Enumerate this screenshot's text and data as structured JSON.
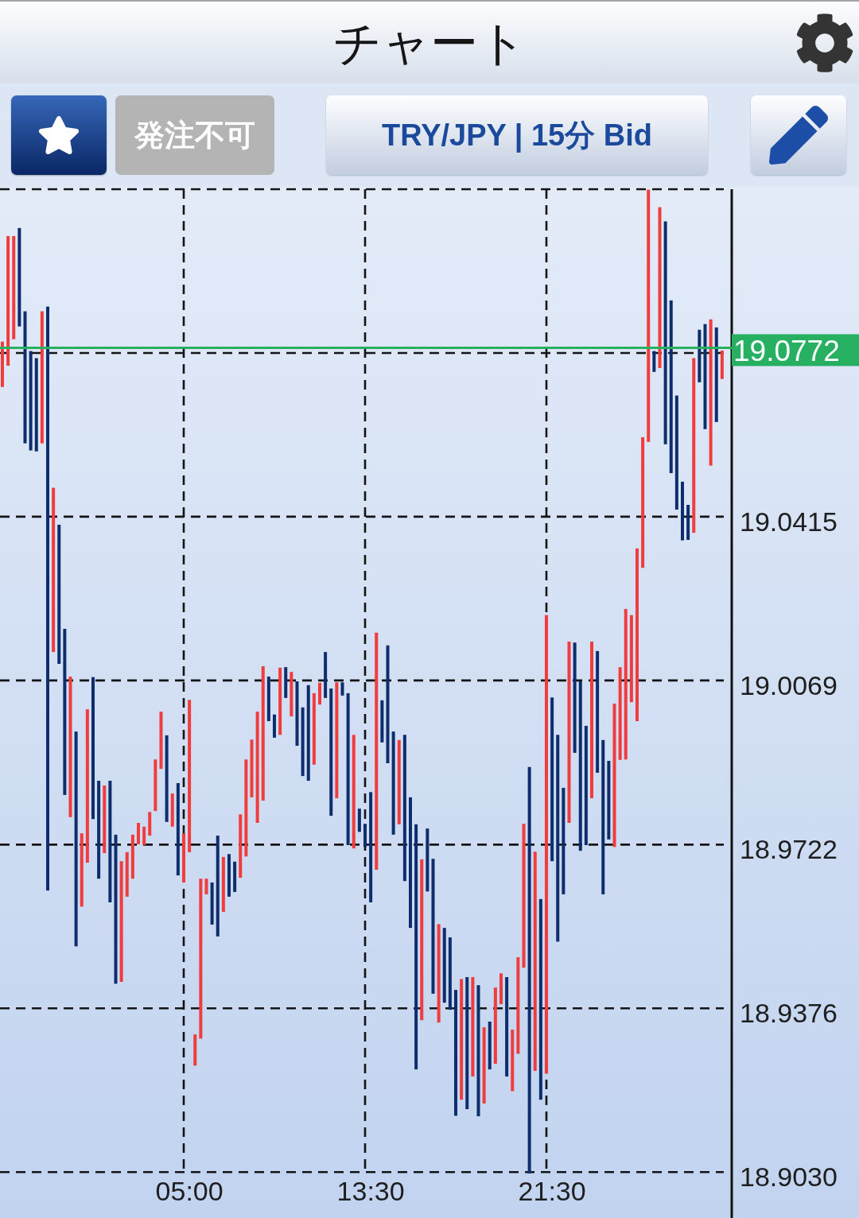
{
  "header": {
    "title": "チャート"
  },
  "toolbar": {
    "buttons": [
      {
        "kind": "favorite"
      },
      {
        "kind": "order",
        "label": "発注不可",
        "disabled": true
      },
      {
        "kind": "symbol",
        "label": "TRY/JPY | 15分 Bid",
        "disabled": false
      },
      {
        "kind": "pen"
      }
    ]
  },
  "chart": {
    "chart_data": {
      "type": "candlestick",
      "grid": true,
      "categories": [
        null,
        null,
        null,
        null,
        null,
        null,
        null,
        null,
        null,
        null,
        null,
        null,
        null,
        null,
        null,
        null,
        null,
        null,
        null,
        null,
        null,
        null,
        null,
        null,
        null,
        null,
        null,
        null,
        null,
        null,
        null,
        null,
        null,
        "05:00",
        null,
        null,
        null,
        null,
        null,
        null,
        null,
        null,
        null,
        null,
        null,
        null,
        null,
        null,
        null,
        null,
        null,
        null,
        null,
        null,
        null,
        null,
        null,
        null,
        null,
        null,
        null,
        null,
        null,
        null,
        null,
        "13:30",
        null,
        null,
        null,
        null,
        null,
        null,
        null,
        null,
        null,
        null,
        null,
        null,
        null,
        null,
        null,
        null,
        null,
        null,
        null,
        null,
        null,
        null,
        null,
        null,
        null,
        null,
        null,
        null,
        null,
        null,
        null,
        "21:30",
        null,
        null,
        null,
        null,
        null,
        null,
        null,
        null,
        null,
        null,
        null,
        null,
        null,
        null,
        null,
        null,
        null,
        null,
        null,
        null,
        null,
        null,
        null,
        null,
        null,
        null,
        null,
        null,
        null,
        null
      ],
      "ylim": [
        18.8933,
        19.1107
      ],
      "yticks": [
        {
          "value": 18.903,
          "label": "18.9030"
        },
        {
          "value": 18.9376,
          "label": "18.9376"
        },
        {
          "value": 18.9722,
          "label": "18.9722"
        },
        {
          "value": 19.0069,
          "label": "19.0069"
        },
        {
          "value": 19.0415,
          "label": "19.0415"
        }
      ],
      "series": [
        {
          "ohlc": [
            [
              19.0689,
              19.0785,
              19.0689,
              19.0785
            ],
            [
              19.0734,
              19.1008,
              19.0734,
              19.1008
            ],
            [
              19.079,
              19.1008,
              19.079,
              19.1008
            ],
            [
              19.1025,
              19.1025,
              19.0817,
              19.0817
            ],
            [
              19.0849,
              19.0849,
              19.057,
              19.057
            ],
            [
              19.0765,
              19.0765,
              19.0555,
              19.0555
            ],
            [
              19.075,
              19.075,
              19.0553,
              19.0553
            ],
            [
              19.057,
              19.0849,
              19.057,
              19.0849
            ],
            [
              19.0859,
              19.0859,
              18.9625,
              18.9625
            ],
            [
              19.0129,
              19.0476,
              19.0129,
              19.0476
            ],
            [
              19.0398,
              19.0398,
              19.0104,
              19.0104
            ],
            [
              19.0178,
              19.0178,
              18.9827,
              18.9827
            ],
            [
              18.978,
              19.0077,
              18.978,
              19.0077
            ],
            [
              18.9961,
              18.9961,
              18.9507,
              18.9507
            ],
            [
              18.9591,
              18.9746,
              18.9591,
              18.9746
            ],
            [
              18.9684,
              19.0008,
              18.9684,
              19.0008
            ],
            [
              19.0076,
              19.0076,
              18.9776,
              18.9776
            ],
            [
              18.9857,
              18.9857,
              18.965,
              18.965
            ],
            [
              18.9704,
              18.9847,
              18.9704,
              18.9847
            ],
            [
              18.9857,
              18.9857,
              18.96,
              18.96
            ],
            [
              18.9743,
              18.9743,
              18.9428,
              18.9428
            ],
            [
              18.9432,
              18.9687,
              18.9432,
              18.9687
            ],
            [
              18.9612,
              18.9706,
              18.9612,
              18.9706
            ],
            [
              18.965,
              18.9743,
              18.965,
              18.9743
            ],
            [
              18.9723,
              18.9768,
              18.9723,
              18.9768
            ],
            [
              18.9721,
              18.976,
              18.9721,
              18.976
            ],
            [
              18.9741,
              18.9791,
              18.9741,
              18.9791
            ],
            [
              18.9793,
              18.9902,
              18.9793,
              18.9902
            ],
            [
              18.9882,
              19.0003,
              18.9882,
              19.0003
            ],
            [
              18.9953,
              18.9953,
              18.977,
              18.977
            ],
            [
              18.976,
              18.983,
              18.976,
              18.983
            ],
            [
              18.9852,
              18.9852,
              18.9657,
              18.9657
            ],
            [
              18.9642,
              18.9746,
              18.9642,
              18.9746
            ],
            [
              18.9706,
              19.0028,
              18.9706,
              19.0028
            ],
            [
              18.9255,
              18.9321,
              18.9255,
              18.9321
            ],
            [
              18.9312,
              18.965,
              18.9312,
              18.965
            ],
            [
              18.9617,
              18.965,
              18.9617,
              18.965
            ],
            [
              18.9642,
              18.9642,
              18.9553,
              18.9553
            ],
            [
              18.9741,
              18.9741,
              18.9528,
              18.9528
            ],
            [
              18.958,
              18.9696,
              18.958,
              18.9696
            ],
            [
              18.9702,
              18.9702,
              18.9612,
              18.9612
            ],
            [
              18.9686,
              18.9686,
              18.9622,
              18.9622
            ],
            [
              18.9652,
              18.9786,
              18.9652,
              18.9786
            ],
            [
              18.9697,
              18.9902,
              18.9697,
              18.9902
            ],
            [
              18.9822,
              18.9944,
              18.9822,
              18.9944
            ],
            [
              18.9768,
              19.0003,
              18.9768,
              19.0003
            ],
            [
              18.9815,
              19.0099,
              18.9815,
              19.0099
            ],
            [
              19.0077,
              19.0077,
              18.9983,
              18.9983
            ],
            [
              18.9997,
              18.9997,
              18.9948,
              18.9948
            ],
            [
              18.9954,
              19.0096,
              18.9954,
              19.0096
            ],
            [
              19.0097,
              19.0097,
              19.0032,
              19.0032
            ],
            [
              18.9993,
              19.0087,
              18.9993,
              19.0087
            ],
            [
              19.0067,
              19.0067,
              18.9931,
              18.9931
            ],
            [
              19.0012,
              19.0012,
              18.9867,
              18.9867
            ],
            [
              19.0059,
              19.0059,
              18.9857,
              18.9857
            ],
            [
              18.9891,
              19.0042,
              18.9891,
              19.0042
            ],
            [
              19.0018,
              19.0064,
              19.0018,
              19.0064
            ],
            [
              19.0129,
              19.0129,
              19.0032,
              19.0032
            ],
            [
              19.0052,
              19.0052,
              18.9783,
              18.9783
            ],
            [
              18.982,
              19.0065,
              18.982,
              19.0065
            ],
            [
              19.0065,
              19.0065,
              19.0037,
              19.0037
            ],
            [
              19.0042,
              19.0042,
              18.9721,
              18.9721
            ],
            [
              18.9714,
              18.9954,
              18.9714,
              18.9954
            ],
            [
              18.9798,
              18.9798,
              18.9749,
              18.9749
            ],
            [
              18.9766,
              18.9766,
              18.9717,
              18.9717
            ],
            [
              18.9833,
              18.9833,
              18.96,
              18.96
            ],
            [
              18.9669,
              19.017,
              18.9669,
              19.017
            ],
            [
              19.0027,
              19.0027,
              18.9938,
              18.9938
            ],
            [
              19.0143,
              19.0143,
              18.9894,
              18.9894
            ],
            [
              18.9961,
              18.9961,
              18.9743,
              18.9743
            ],
            [
              18.9765,
              18.9943,
              18.9765,
              18.9943
            ],
            [
              18.9954,
              18.9954,
              18.9645,
              18.9645
            ],
            [
              18.9822,
              18.9822,
              18.9546,
              18.9546
            ],
            [
              18.9765,
              18.9765,
              18.9247,
              18.9247
            ],
            [
              18.9351,
              18.9691,
              18.9351,
              18.9691
            ],
            [
              18.9756,
              18.9756,
              18.9623,
              18.9623
            ],
            [
              18.9692,
              18.9692,
              18.9407,
              18.9407
            ],
            [
              18.9346,
              18.9554,
              18.9346,
              18.9554
            ],
            [
              18.9546,
              18.9546,
              18.9388,
              18.9388
            ],
            [
              18.9526,
              18.9526,
              18.9373,
              18.9373
            ],
            [
              18.9415,
              18.9415,
              18.9149,
              18.9149
            ],
            [
              18.9183,
              18.9438,
              18.9183,
              18.9438
            ],
            [
              18.9442,
              18.9442,
              18.9163,
              18.9163
            ],
            [
              18.9232,
              18.9442,
              18.9232,
              18.9442
            ],
            [
              18.9425,
              18.9425,
              18.9148,
              18.9148
            ],
            [
              18.9175,
              18.9336,
              18.9175,
              18.9336
            ],
            [
              18.9348,
              18.9348,
              18.9247,
              18.9247
            ],
            [
              18.9259,
              18.942,
              18.9259,
              18.942
            ],
            [
              18.9385,
              18.945,
              18.9385,
              18.945
            ],
            [
              18.9442,
              18.9442,
              18.9232,
              18.9232
            ],
            [
              18.9201,
              18.9331,
              18.9201,
              18.9331
            ],
            [
              18.928,
              18.9484,
              18.928,
              18.9484
            ],
            [
              18.9462,
              18.9766,
              18.9462,
              18.9766
            ],
            [
              18.9886,
              18.9886,
              18.9027,
              18.9027
            ],
            [
              18.9244,
              18.9707,
              18.9244,
              18.9707
            ],
            [
              18.9607,
              18.9607,
              18.9183,
              18.9183
            ],
            [
              18.9238,
              19.0207,
              18.9238,
              19.0207
            ],
            [
              19.0033,
              19.0033,
              18.9687,
              18.9687
            ],
            [
              18.9954,
              18.9954,
              18.9517,
              18.9517
            ],
            [
              18.9842,
              18.9842,
              18.9617,
              18.9617
            ],
            [
              18.9768,
              19.0151,
              18.9768,
              19.0151
            ],
            [
              19.0149,
              19.0149,
              18.9916,
              18.9916
            ],
            [
              19.0067,
              19.0067,
              18.9709,
              18.9709
            ],
            [
              18.9973,
              18.9973,
              18.9721,
              18.9721
            ],
            [
              18.982,
              19.0151,
              18.982,
              19.0151
            ],
            [
              19.0131,
              19.0131,
              18.9874,
              18.9874
            ],
            [
              18.9943,
              18.9943,
              18.9617,
              18.9617
            ],
            [
              18.9899,
              18.9899,
              18.9733,
              18.9733
            ],
            [
              18.9717,
              19.002,
              18.9717,
              19.002
            ],
            [
              18.9901,
              19.0097,
              18.9901,
              19.0097
            ],
            [
              18.9902,
              19.022,
              18.9902,
              19.022
            ],
            [
              19.0023,
              19.0207,
              19.0023,
              19.0207
            ],
            [
              18.9983,
              19.0348,
              18.9983,
              19.0348
            ],
            [
              19.0307,
              19.0583,
              19.0307,
              19.0583
            ],
            [
              19.0573,
              19.1106,
              19.0573,
              19.1106
            ],
            [
              19.0765,
              19.0765,
              19.0721,
              19.0721
            ],
            [
              19.0729,
              19.1069,
              19.0729,
              19.1069
            ],
            [
              19.1039,
              19.1039,
              19.0568,
              19.0568
            ],
            [
              19.0872,
              19.0872,
              19.0507,
              19.0507
            ],
            [
              19.0671,
              19.0671,
              19.043,
              19.043
            ],
            [
              19.0489,
              19.0489,
              19.0365,
              19.0365
            ],
            [
              19.044,
              19.044,
              19.0366,
              19.0366
            ],
            [
              19.0381,
              19.075,
              19.0381,
              19.075
            ],
            [
              19.081,
              19.081,
              19.0699,
              19.0699
            ],
            [
              19.0822,
              19.0822,
              19.06,
              19.06
            ],
            [
              19.0523,
              19.0832,
              19.0523,
              19.0832
            ],
            [
              19.0815,
              19.0815,
              19.0615,
              19.0615
            ],
            [
              19.0706,
              19.0766,
              19.0706,
              19.0766
            ]
          ]
        }
      ],
      "ref_lines": [
        {
          "axis": "y",
          "value": 19.0772,
          "label": "19.0772",
          "color": "#27b062"
        }
      ]
    }
  }
}
